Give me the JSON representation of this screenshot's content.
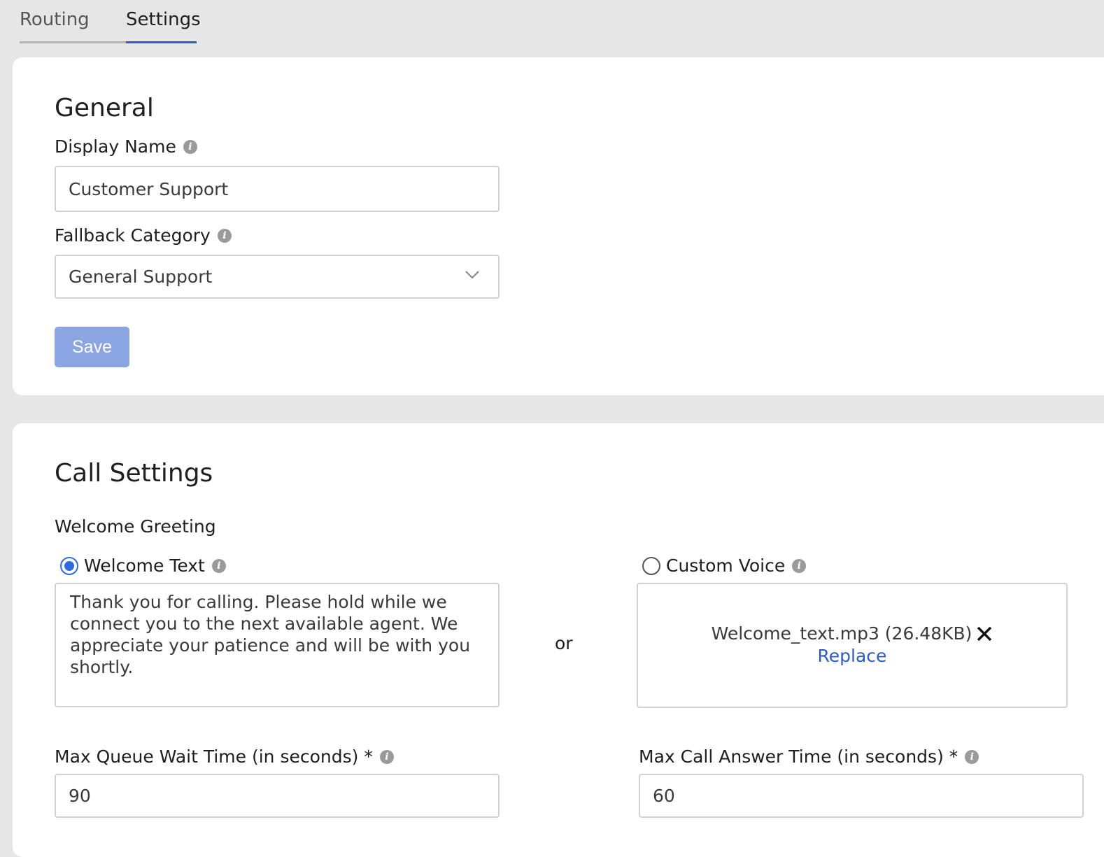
{
  "tabs": [
    {
      "label": "Routing"
    },
    {
      "label": "Settings"
    }
  ],
  "general": {
    "title": "General",
    "display_name_label": "Display Name",
    "display_name_value": "Customer Support",
    "fallback_label": "Fallback Category",
    "fallback_value": "General Support",
    "save_label": "Save"
  },
  "call": {
    "title": "Call Settings",
    "welcome_greeting_label": "Welcome Greeting",
    "welcome_text_label": "Welcome Text",
    "welcome_text_value": "Thank you for calling. Please hold while we connect you to the next available agent. We appreciate your patience and will be with you shortly.",
    "or_label": "or",
    "custom_voice_label": "Custom Voice",
    "file_name": "Welcome_text.mp3 (26.48KB)",
    "replace_label": "Replace",
    "max_queue_label": "Max Queue Wait Time (in seconds) *",
    "max_queue_value": "90",
    "max_answer_label": "Max Call Answer Time (in seconds) *",
    "max_answer_value": "60"
  },
  "colors": {
    "accent": "#2e5cc4",
    "save_button": "#8aa5e2",
    "radio_checked": "#2e6be0"
  }
}
